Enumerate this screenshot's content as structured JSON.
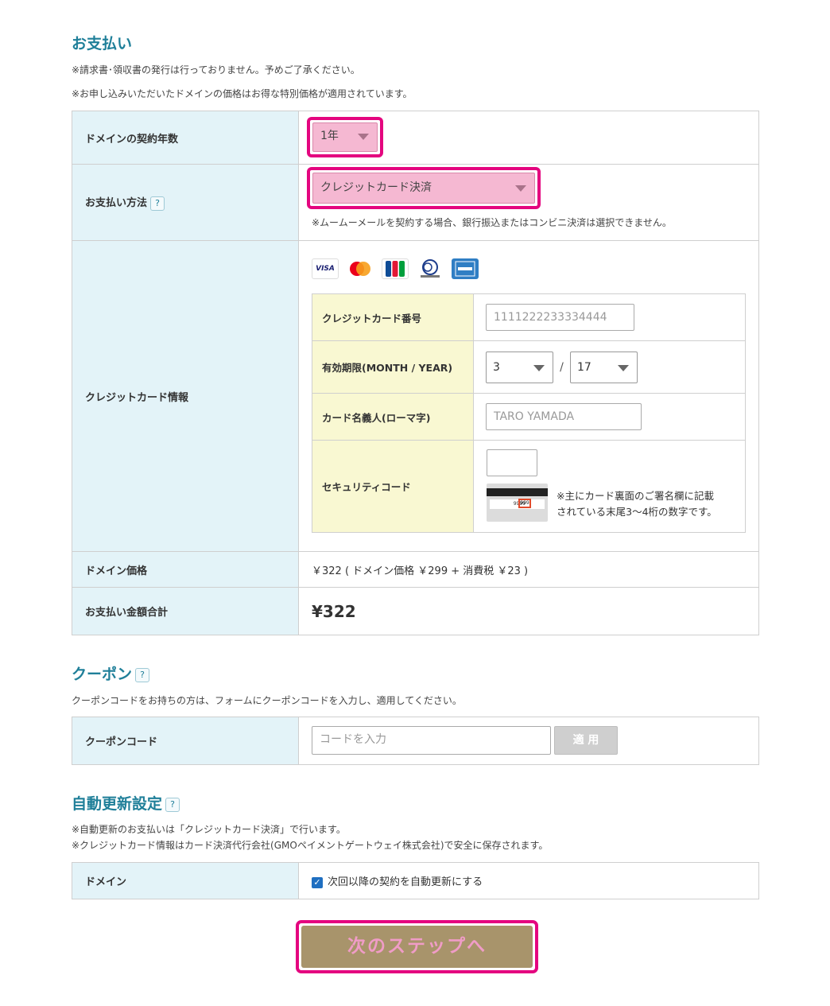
{
  "payment": {
    "title": "お支払い",
    "notes": [
      "※請求書･領収書の発行は行っておりません。予めご了承ください。",
      "※お申し込みいただいたドメインの価格はお得な特別価格が適用されています。"
    ],
    "contract_years_label": "ドメインの契約年数",
    "contract_years_value": "1年",
    "method_label": "お支払い方法",
    "method_value": "クレジットカード決済",
    "method_note": "※ムームーメールを契約する場合、銀行振込またはコンビニ決済は選択できません。",
    "card_info_label": "クレジットカード情報",
    "card_brands": [
      "VISA",
      "MasterCard",
      "JCB",
      "Diners Club International",
      "American Express"
    ],
    "card_number_label": "クレジットカード番号",
    "card_number_placeholder": "1111222233334444",
    "expiry_label": "有効期限(MONTH / YEAR)",
    "expiry_month": "3",
    "expiry_separator": "/",
    "expiry_year": "17",
    "holder_label": "カード名義人(ローマ字)",
    "holder_placeholder": "TARO YAMADA",
    "security_label": "セキュリティコード",
    "security_note_1": "※主にカード裏面のご署名欄に記載",
    "security_note_2": "されている末尾3～4桁の数字です。",
    "security_img_digits": "9999",
    "security_img_code": "999",
    "price_label": "ドメイン価格",
    "price_value": "￥322 ( ドメイン価格 ￥299 + 消費税 ￥23 )",
    "total_label": "お支払い金額合計",
    "total_value": "¥322"
  },
  "coupon": {
    "title": "クーポン",
    "note": "クーポンコードをお持ちの方は、フォームにクーポンコードを入力し、適用してください。",
    "code_label": "クーポンコード",
    "code_placeholder": "コードを入力",
    "apply_label": "適 用"
  },
  "auto_renew": {
    "title": "自動更新設定",
    "notes": [
      "※自動更新のお支払いは「クレジットカード決済」で行います。",
      "※クレジットカード情報はカード決済代行会社(GMOペイメントゲートウェイ株式会社)で安全に保存されます。"
    ],
    "domain_label": "ドメイン",
    "checkbox_label": "次回以降の契約を自動更新にする",
    "checked": true
  },
  "help_icon_text": "?",
  "next_button_label": "次のステップへ",
  "colors": {
    "accent": "#1f7f99",
    "highlight": "#e4057f",
    "select_bg": "#f5b8d2",
    "next_bg": "#a8946b"
  }
}
